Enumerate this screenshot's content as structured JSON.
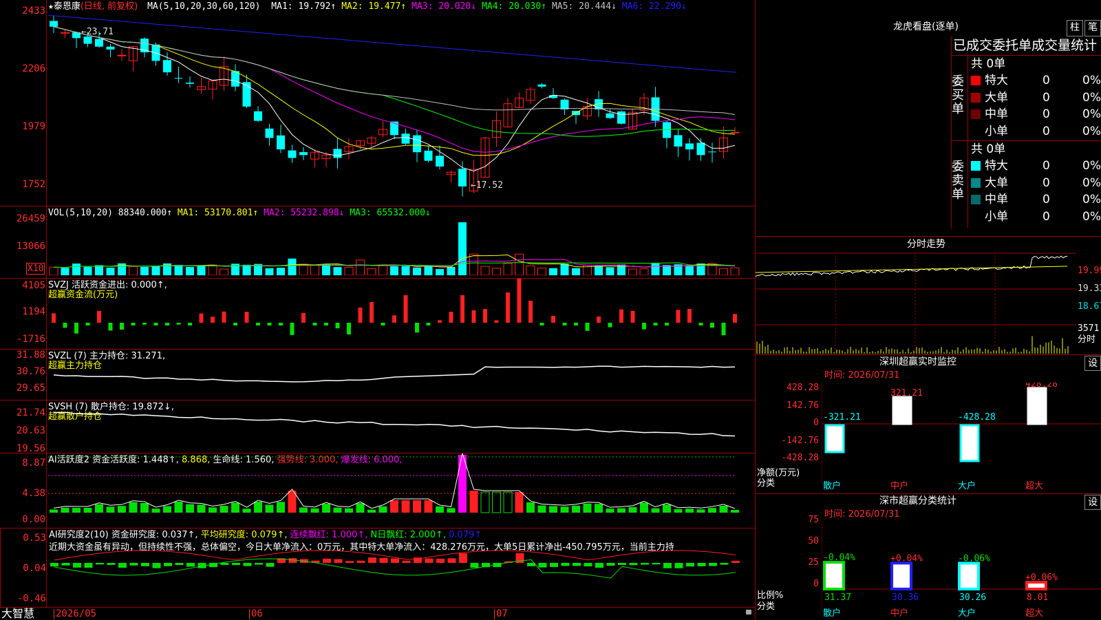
{
  "stock": {
    "name": "泰恩康",
    "mode": "(日线, 前复权)",
    "star": "★"
  },
  "ma_bar": {
    "params": "MA(5,10,20,30,60,120)",
    "items": [
      {
        "label": "MA1: 19.792↑",
        "color": "#ffffff"
      },
      {
        "label": "MA2: 19.477↑",
        "color": "#ffff00"
      },
      {
        "label": "MA3: 20.020↓",
        "color": "#ff00ff"
      },
      {
        "label": "MA4: 20.030↑",
        "color": "#00ff00"
      },
      {
        "label": "MA5: 20.444↓",
        "color": "#c0c0c0"
      },
      {
        "label": "MA6: 22.290↓",
        "color": "#2020ff"
      }
    ]
  },
  "main_axis": [
    "2433",
    "2206",
    "1979",
    "1752"
  ],
  "annotations": {
    "high": "←23.71",
    "low": "←17.52"
  },
  "vol": {
    "header": "VOL(5,10,20)",
    "value": "88340.000↑",
    "ma1": "MA1: 53170.801↑",
    "ma2": "MA2: 55232.898↓",
    "ma3": "MA3: 65532.000↓",
    "axis": [
      "26459",
      "13066"
    ],
    "unit": "X10"
  },
  "svzj": {
    "line1": "SVZJ  活跃资金进出: 0.000↑,",
    "line2": "超赢资金流(万元)",
    "axis": [
      "4105",
      "1194",
      "-1716"
    ]
  },
  "svzl": {
    "line1": "SVZL (7) 主力持仓: 31.271,",
    "line2": "超赢主力持仓",
    "axis": [
      "31.88",
      "30.76",
      "29.65"
    ]
  },
  "svsh": {
    "line1": "SVSH (7) 散户持仓: 19.872↓,",
    "line2": "超赢散户持仓",
    "axis": [
      "21.74",
      "20.63",
      "19.56"
    ]
  },
  "ai1": {
    "title": "AI活跃度2 资金活跃度: 1.448↑,",
    "v2": "8.868,",
    "life": "生命线: 1.560,",
    "strong": "强势线: 3.000,",
    "burst": "爆发线: 6.000,",
    "axis": [
      "8.87",
      "4.38",
      "0.00"
    ]
  },
  "ai2": {
    "title": "AI研究度2(10) 资金研究度: 0.037↑,",
    "avg": "平均研究度: 0.079↑,",
    "cont": "连续飘红: 1.000↑,",
    "nday": "N日飘红: 2.000↑,",
    "last": "0.079↑",
    "comment": "近期大资金虽有异动，但持续性不强，总体偏空，今日大单净流入：0万元，其中特大单净流入：428.276万元，大单5日累计净出-450.795万元，当前主力持",
    "axis": [
      "0.53",
      "0.04",
      "-0.46"
    ]
  },
  "date_axis": {
    "logo": "大智慧",
    "labels": [
      "2026/05",
      "06",
      "07"
    ]
  },
  "lh": {
    "title": "龙虎看盘(逐单)",
    "btn1": "柱",
    "btn2": "笔",
    "header": "已成交委托单成交量统计",
    "buy_label": "委买单",
    "sell_label": "委卖单",
    "buy_total": "共 0单",
    "sell_total": "共 0单",
    "buy_rows": [
      {
        "name": "特大",
        "count": "0",
        "pct": "0%",
        "color": "#ff0000"
      },
      {
        "name": "大单",
        "count": "0",
        "pct": "0%",
        "color": "#a00000"
      },
      {
        "name": "中单",
        "count": "0",
        "pct": "0%",
        "color": "#700000"
      },
      {
        "name": "小单",
        "count": "0",
        "pct": "0%",
        "color": ""
      }
    ],
    "sell_rows": [
      {
        "name": "特大",
        "count": "0",
        "pct": "0%",
        "color": "#00ffff"
      },
      {
        "name": "大单",
        "count": "0",
        "pct": "0%",
        "color": "#008a8a"
      },
      {
        "name": "中单",
        "count": "0",
        "pct": "0%",
        "color": "#006a6a"
      },
      {
        "name": "小单",
        "count": "0",
        "pct": "0%",
        "color": ""
      }
    ]
  },
  "intraday": {
    "title": "分时走势",
    "axis": [
      "19.99",
      "19.33",
      "18.67"
    ],
    "vol": "3571",
    "vol_lbl": "分时"
  },
  "monitor": {
    "title": "深圳超赢实时监控",
    "set": "设",
    "time": "时间: 2026/07/31",
    "axis": [
      "428.28",
      "142.76",
      "0",
      "-142.76",
      "-428.28"
    ],
    "values": [
      "-321.21",
      "321.21",
      "-428.28",
      "428.28"
    ],
    "ylabel": "净额(万元)",
    "xlabel": "分类",
    "cats": [
      "散户",
      "中户",
      "大户",
      "超大"
    ]
  },
  "classify": {
    "title": "深市超赢分类统计",
    "set": "设",
    "time": "时间: 2026/07/31",
    "axis": [
      "75",
      "50",
      "25",
      "0"
    ],
    "changes": [
      "-0.04%",
      "+0.04%",
      "-0.06%",
      "+0.06%"
    ],
    "values": [
      "31.37",
      "30.36",
      "30.26",
      "8.01"
    ],
    "ylabel": "比例%",
    "xlabel": "分类",
    "cats": [
      "散户",
      "中户",
      "大户",
      "超大"
    ]
  }
}
